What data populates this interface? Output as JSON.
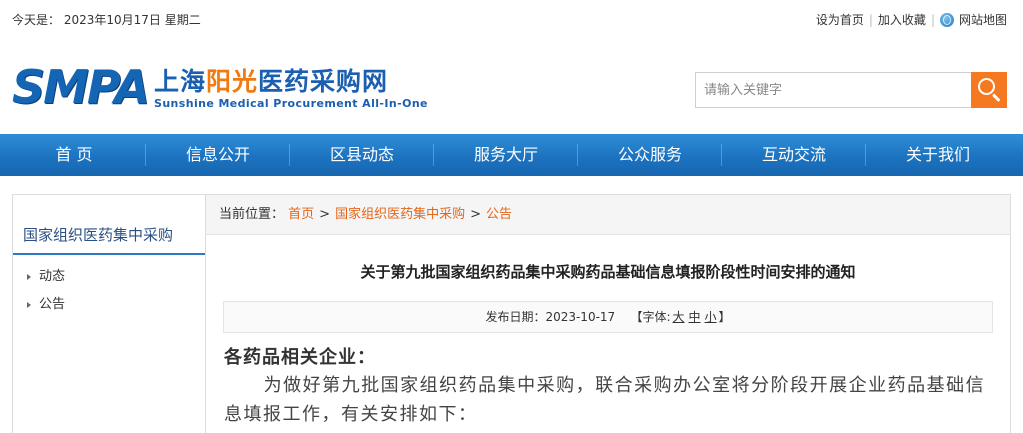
{
  "topbar": {
    "date_text": "今天是： 2023年10月17日 星期二",
    "set_home": "设为首页",
    "add_favorite": "加入收藏",
    "site_map": "网站地图",
    "separator": "|"
  },
  "logo": {
    "abbr": "SMPA",
    "cn_part1": "上海",
    "cn_part2": "阳光",
    "cn_part3": "医药采购网",
    "en": "Sunshine Medical Procurement All-In-One",
    "colors": {
      "blue": "#1565b5",
      "orange": "#f07a10"
    }
  },
  "search": {
    "placeholder": "请输入关键字",
    "button_color": "#f47920"
  },
  "nav": {
    "items": [
      "首 页",
      "信息公开",
      "区县动态",
      "服务大厅",
      "公众服务",
      "互动交流",
      "关于我们"
    ],
    "color": "#1c73c0"
  },
  "sidebar": {
    "title": "国家组织医药集中采购",
    "items": [
      "动态",
      "公告"
    ]
  },
  "breadcrumb": {
    "label": "当前位置：",
    "items": [
      "首页",
      "国家组织医药集中采购",
      "公告"
    ],
    "separator": ">"
  },
  "article": {
    "title": "关于第九批国家组织药品集中采购药品基础信息填报阶段性时间安排的通知",
    "publish_label": "发布日期：2023-10-17",
    "font_label": "【字体:",
    "font_large": "大",
    "font_medium": "中",
    "font_small": "小",
    "font_close": "】",
    "salutation": "各药品相关企业：",
    "paragraph": "为做好第九批国家组织药品集中采购，联合采购办公室将分阶段开展企业药品基础信息填报工作，有关安排如下："
  }
}
